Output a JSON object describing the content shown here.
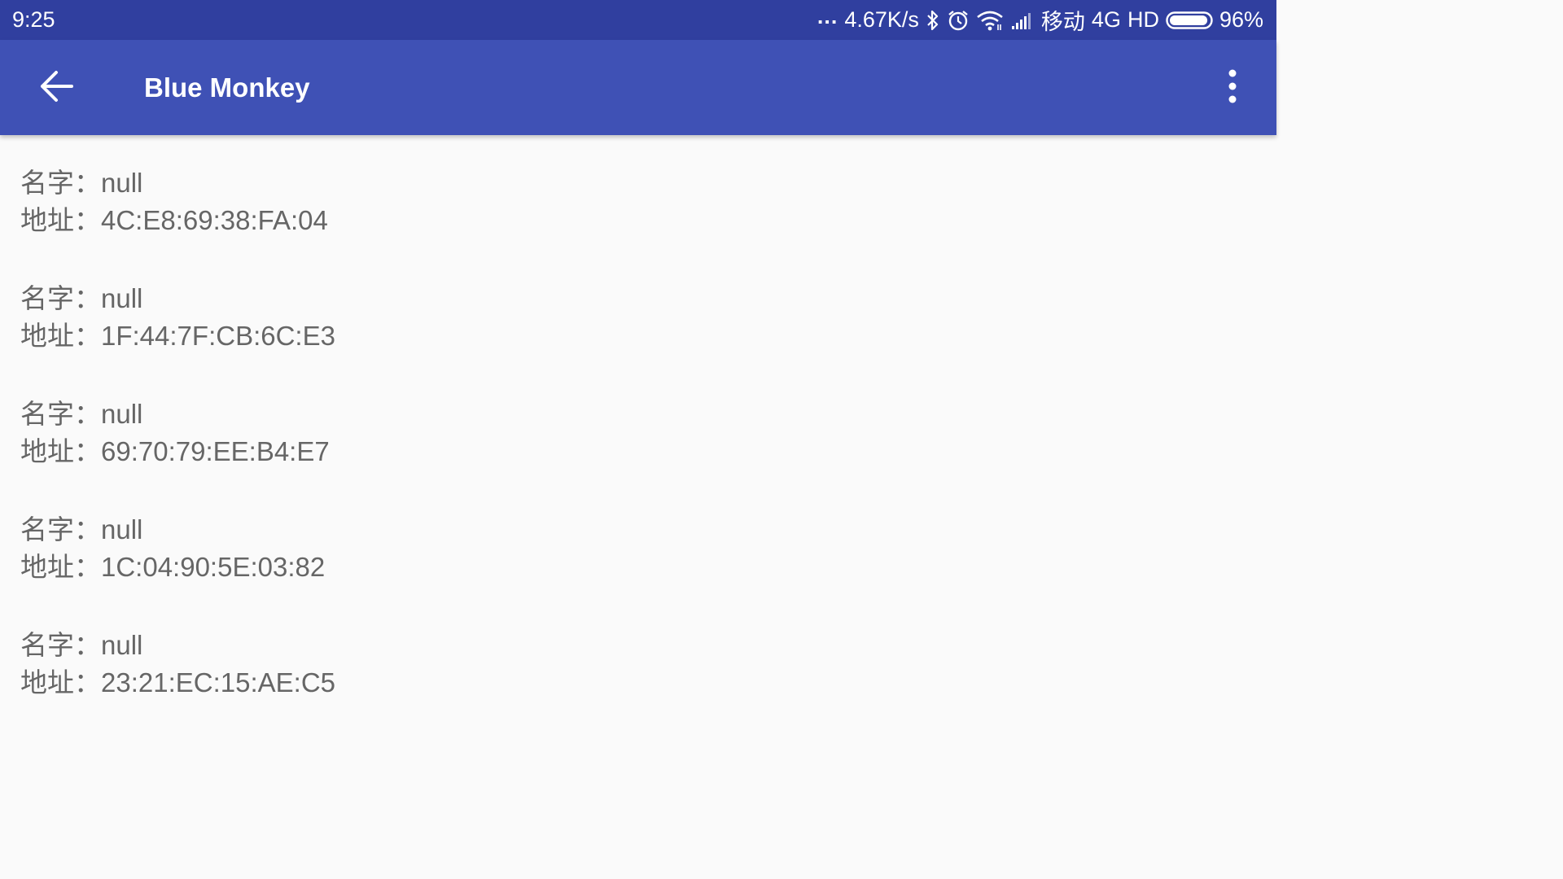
{
  "status_bar": {
    "time": "9:25",
    "dots": "...",
    "net_speed": "4.67K/s",
    "carrier": "移动",
    "network_type": "4G",
    "hd": "HD",
    "battery": "96%",
    "battery_level": 0.96,
    "icons": [
      "bluetooth-icon",
      "alarm-icon",
      "wifi-icon",
      "cell-signal-icon",
      "battery-icon"
    ]
  },
  "app_bar": {
    "title": "Blue Monkey",
    "back_icon": "arrow-left-icon",
    "menu_icon": "more-vertical-icon",
    "color": "#3f51b5",
    "status_color": "#303f9f"
  },
  "labels": {
    "name": "名字：",
    "address": "地址："
  },
  "devices": [
    {
      "name": "null",
      "address": "4C:E8:69:38:FA:04"
    },
    {
      "name": "null",
      "address": "1F:44:7F:CB:6C:E3"
    },
    {
      "name": "null",
      "address": "69:70:79:EE:B4:E7"
    },
    {
      "name": "null",
      "address": "1C:04:90:5E:03:82"
    },
    {
      "name": "null",
      "address": "23:21:EC:15:AE:C5"
    }
  ]
}
